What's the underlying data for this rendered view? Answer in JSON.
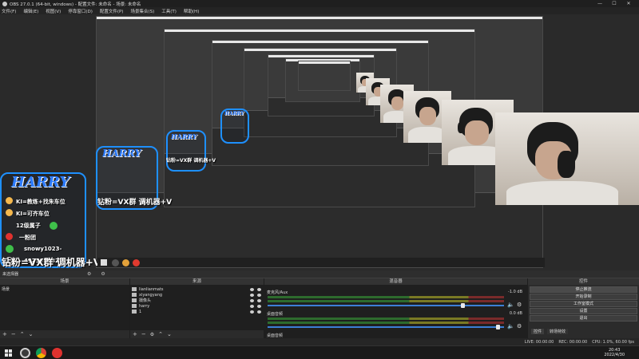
{
  "window": {
    "title": "OBS 27.0.1 (64-bit, windows) - 配置文件: 未命名 - 场景: 未命名"
  },
  "menu": [
    "文件(F)",
    "编辑(E)",
    "视图(V)",
    "停靠窗口(D)",
    "配置文件(P)",
    "场景集合(S)",
    "工具(T)",
    "帮助(H)"
  ],
  "overlay": {
    "logo": "HARRY",
    "lines": [
      "KI=教练+找朱车位",
      "KI=可齐车位",
      "12级属子",
      "一粉团",
      "snowy1023-",
      "492565632"
    ],
    "promo": "钻粉=VX群 调机器+V"
  },
  "docks": {
    "scene_transitions_label": "来选择器",
    "scenes": {
      "title": "场景",
      "items": [
        "场景"
      ]
    },
    "sources": {
      "title": "来源",
      "items": [
        {
          "name": "文本(GDI+)",
          "label": "lianlianmats"
        },
        {
          "name": "文本(GDI+)",
          "label": "xiyangyang"
        },
        {
          "name": "视频采集设备",
          "label": "摄像头"
        },
        {
          "name": "文本(GDI+)",
          "label": "harry"
        },
        {
          "name": "图像",
          "label": "1"
        }
      ]
    },
    "mixer": {
      "title": "混音器",
      "channels": [
        {
          "name": "麦克风/Aux",
          "db": "-1.0 dB",
          "level": 0.72
        },
        {
          "name": "桌面音频",
          "db": "0.0 dB",
          "level": 0.93
        },
        {
          "name": "桌面音频",
          "db": "",
          "level": 0.0
        }
      ]
    },
    "controls": {
      "title": "控件",
      "buttons": [
        "停止推流",
        "开始录制",
        "工作室模式",
        "设置",
        "退出"
      ],
      "tabs": [
        "控件",
        "转场特效"
      ]
    }
  },
  "statusbar": {
    "dropped": "LIVE: 00:00:00",
    "rec": "REC: 00:00:00",
    "cpu": "CPU: 1.0%, 60.00 fps"
  },
  "taskbar": {
    "time": "20:43",
    "date": "2022/4/30"
  },
  "colors": {
    "accent": "#1e90ff",
    "bg": "#2b2b2b"
  }
}
